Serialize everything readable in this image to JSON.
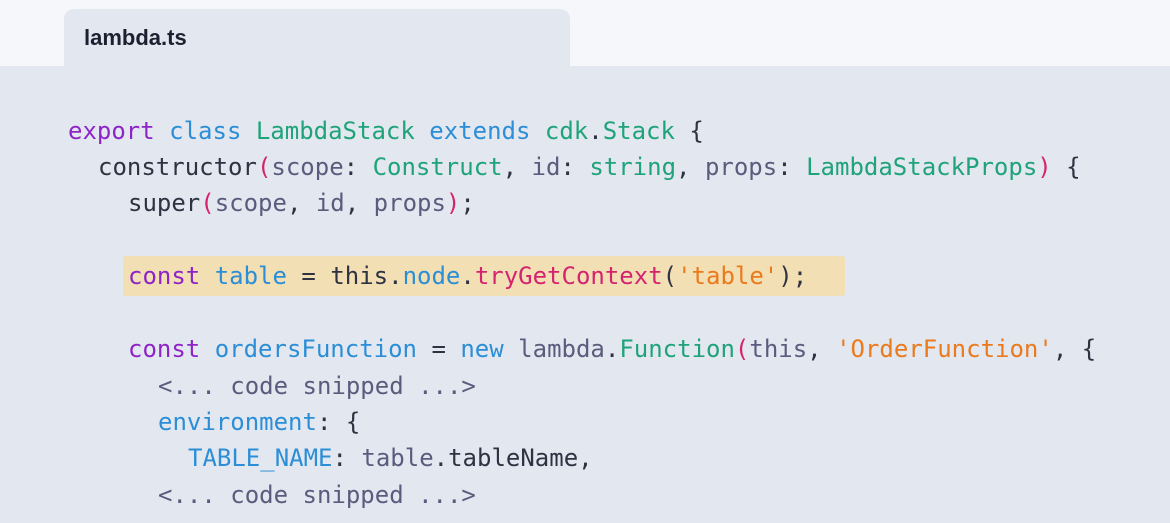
{
  "tab": {
    "filename": "lambda.ts"
  },
  "code": {
    "line1": {
      "t1": "export",
      "t2": " ",
      "t3": "class",
      "t4": " ",
      "t5": "LambdaStack",
      "t6": " ",
      "t7": "extends",
      "t8": " ",
      "t9": "cdk",
      "t10": ".",
      "t11": "Stack",
      "t12": " {"
    },
    "line2": {
      "t1": "constructor",
      "t2": "(",
      "t3": "scope",
      "t4": ": ",
      "t5": "Construct",
      "t6": ", ",
      "t7": "id",
      "t8": ": ",
      "t9": "string",
      "t10": ", ",
      "t11": "props",
      "t12": ": ",
      "t13": "LambdaStackProps",
      "t14": ")",
      "t15": " {"
    },
    "line3": {
      "t1": "super",
      "t2": "(",
      "t3": "scope",
      "t4": ", ",
      "t5": "id",
      "t6": ", ",
      "t7": "props",
      "t8": ")",
      "t9": ";"
    },
    "line5": {
      "t1": "const",
      "t2": " ",
      "t3": "table",
      "t4": " = ",
      "t5": "this",
      "t6": ".",
      "t7": "node",
      "t8": ".",
      "t9": "tryGetContext",
      "t10": "(",
      "t11": "'table'",
      "t12": ")",
      "t13": ";"
    },
    "line7": {
      "t1": "const",
      "t2": " ",
      "t3": "ordersFunction",
      "t4": " = ",
      "t5": "new",
      "t6": " ",
      "t7": "lambda",
      "t8": ".",
      "t9": "Function",
      "t10": "(",
      "t11": "this",
      "t12": ", ",
      "t13": "'OrderFunction'",
      "t14": ", {"
    },
    "line8": {
      "t1": "<... code snipped ...>"
    },
    "line9": {
      "t1": "environment",
      "t2": ": {"
    },
    "line10": {
      "t1": "TABLE_NAME",
      "t2": ": ",
      "t3": "table",
      "t4": ".",
      "t5": "tableName",
      "t6": ","
    },
    "line11": {
      "t1": "<... code snipped ...>"
    }
  }
}
